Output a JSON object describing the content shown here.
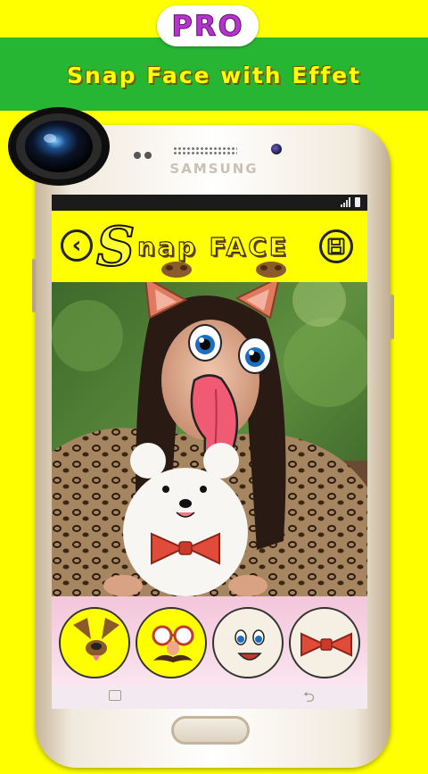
{
  "banner": {
    "pro_label": "PRO",
    "title": "Snap Face with Effet"
  },
  "phone": {
    "brand": "SAMSUNG"
  },
  "app": {
    "title_initial": "S",
    "title_rest": "nap FACE"
  },
  "stickers": [
    {
      "icon": "puppy-face-sticker"
    },
    {
      "icon": "glasses-mustache-sticker"
    },
    {
      "icon": "cartoon-face-sticker"
    },
    {
      "icon": "red-bowtie-sticker"
    }
  ],
  "colors": {
    "background": "#ffff00",
    "band": "#27b633",
    "pro_text": "#b534cc"
  }
}
